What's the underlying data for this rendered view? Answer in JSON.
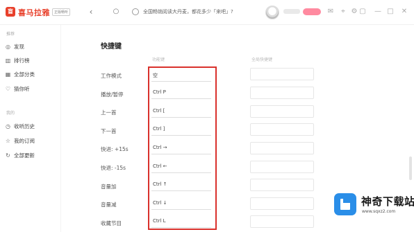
{
  "app": {
    "logo_text": "盲",
    "brand": "喜马拉雅",
    "brand_tag": "正版畅听"
  },
  "search": {
    "text": "全国畅销阅读大丹麦，都花多少「来吧」?"
  },
  "topbar": {
    "icons": [
      "back-icon",
      "refresh-icon",
      "search-icon",
      "message-icon",
      "location-icon",
      "settings-icon",
      "minimize-icon",
      "maximize-icon",
      "close-icon"
    ]
  },
  "sidebar": {
    "section1": "推荐",
    "items1": [
      {
        "icon": "compass-icon",
        "label": "发现"
      },
      {
        "icon": "chart-icon",
        "label": "排行榜"
      },
      {
        "icon": "grid-icon",
        "label": "全部分类"
      },
      {
        "icon": "heart-icon",
        "label": "猜你听"
      }
    ],
    "section2": "我的",
    "items2": [
      {
        "icon": "history-icon",
        "label": "收听历史"
      },
      {
        "icon": "star-icon",
        "label": "我的订阅"
      },
      {
        "icon": "refresh-icon",
        "label": "全部更新"
      }
    ]
  },
  "main": {
    "title": "快捷键",
    "col_head_1": "功能键",
    "col_head_2": "全局快捷键",
    "rows": [
      {
        "label": "工作模式",
        "key": "空"
      },
      {
        "label": "播放/暂停",
        "key": "Ctrl P"
      },
      {
        "label": "上一首",
        "key": "Ctrl ["
      },
      {
        "label": "下一首",
        "key": "Ctrl ]"
      },
      {
        "label": "快进: +15s",
        "key": "Ctrl →"
      },
      {
        "label": "快退: -15s",
        "key": "Ctrl ←"
      },
      {
        "label": "音量加",
        "key": "Ctrl ↑"
      },
      {
        "label": "音量减",
        "key": "Ctrl ↓"
      },
      {
        "label": "收藏节目",
        "key": "Ctrl L"
      }
    ]
  },
  "watermark": {
    "title": "神奇下载站",
    "url": "www.sqxz2.com"
  },
  "colors": {
    "brand_red": "#e8402b",
    "highlight_red": "#d9302b",
    "watermark_blue": "#2a8ee8"
  }
}
